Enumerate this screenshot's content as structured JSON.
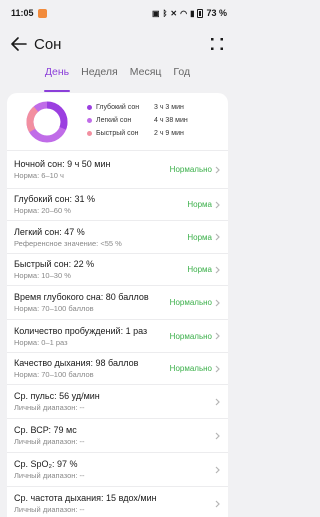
{
  "status_bar": {
    "time": "11:05",
    "battery_pct": "73 %"
  },
  "header": {
    "title": "Сон"
  },
  "tabs": [
    {
      "label": "День",
      "active": true
    },
    {
      "label": "Неделя",
      "active": false
    },
    {
      "label": "Месяц",
      "active": false
    },
    {
      "label": "Год",
      "active": false
    }
  ],
  "summary": {
    "legend": [
      {
        "name": "Глубокий сон",
        "value": "3 ч 3 мин",
        "color": "#9b3fe0"
      },
      {
        "name": "Легкий сон",
        "value": "4 ч 38 мин",
        "color": "#c06ce8"
      },
      {
        "name": "Быстрый сон",
        "value": "2 ч 9 мин",
        "color": "#f28fa0"
      }
    ]
  },
  "rows": [
    {
      "title": "Ночной сон: 9 ч 50 мин",
      "sub": "Норма: 6–10 ч",
      "status": "Нормально"
    },
    {
      "title": "Глубокий сон: 31 %",
      "sub": "Норма: 20–60 %",
      "status": "Норма"
    },
    {
      "title": "Легкий сон: 47 %",
      "sub": "Референсное значение: <55 %",
      "status": "Норма"
    },
    {
      "title": "Быстрый сон: 22 %",
      "sub": "Норма: 10–30 %",
      "status": "Норма"
    },
    {
      "title": "Время глубокого сна: 80 баллов",
      "sub": "Норма: 70–100 баллов",
      "status": "Нормально"
    },
    {
      "title": "Количество пробуждений: 1 раз",
      "sub": "Норма: 0–1 раз",
      "status": "Нормально"
    },
    {
      "title": "Качество дыхания: 98 баллов",
      "sub": "Норма: 70–100 баллов",
      "status": "Нормально"
    },
    {
      "title": "Ср. пульс: 56 уд/мин",
      "sub": "Личный диапазон: --",
      "status": ""
    },
    {
      "title": "Ср. ВСР: 79 мс",
      "sub": "Личный диапазон: --",
      "status": ""
    },
    {
      "title": "Ср. SpO₂: 97 %",
      "sub": "Личный диапазон: --",
      "status": ""
    },
    {
      "title": "Ср. частота дыхания: 15 вдох/мин",
      "sub": "Личный диапазон: --",
      "status": ""
    }
  ]
}
